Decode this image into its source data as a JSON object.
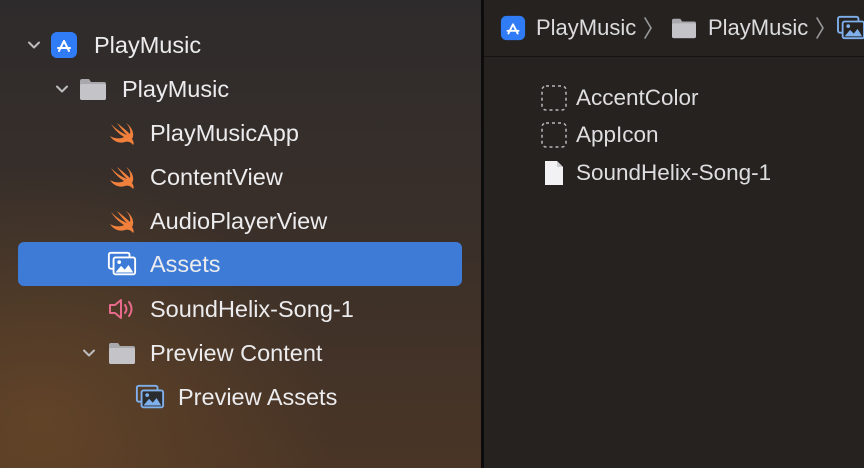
{
  "navigator": {
    "items": [
      {
        "label": "PlayMusic",
        "icon": "app-store-icon",
        "depth": 0
      },
      {
        "label": "PlayMusic",
        "icon": "folder-icon",
        "depth": 1
      },
      {
        "label": "PlayMusicApp",
        "icon": "swift-icon",
        "depth": 2
      },
      {
        "label": "ContentView",
        "icon": "swift-icon",
        "depth": 2
      },
      {
        "label": "AudioPlayerView",
        "icon": "swift-icon",
        "depth": 2
      },
      {
        "label": "Assets",
        "icon": "asset-catalog-icon",
        "depth": 2,
        "selected": true
      },
      {
        "label": "SoundHelix-Song-1",
        "icon": "audio-file-icon",
        "depth": 2
      },
      {
        "label": "Preview Content",
        "icon": "folder-icon",
        "depth": 2
      },
      {
        "label": "Preview Assets",
        "icon": "asset-catalog-icon",
        "depth": 3
      }
    ]
  },
  "breadcrumb": {
    "items": [
      {
        "label": "PlayMusic",
        "icon": "app-store-icon"
      },
      {
        "label": "PlayMusic",
        "icon": "folder-icon"
      },
      {
        "label": "",
        "icon": "asset-catalog-icon"
      }
    ]
  },
  "assets": {
    "items": [
      {
        "label": "AccentColor",
        "icon": "color-set-placeholder-icon"
      },
      {
        "label": "AppIcon",
        "icon": "app-icon-placeholder-icon"
      },
      {
        "label": "SoundHelix-Song-1",
        "icon": "data-file-icon"
      }
    ]
  },
  "colors": {
    "selection": "#3d7bd6",
    "swift": "#f0803c",
    "audio": "#e86a8a",
    "app_icon": "#2f7cf6"
  }
}
